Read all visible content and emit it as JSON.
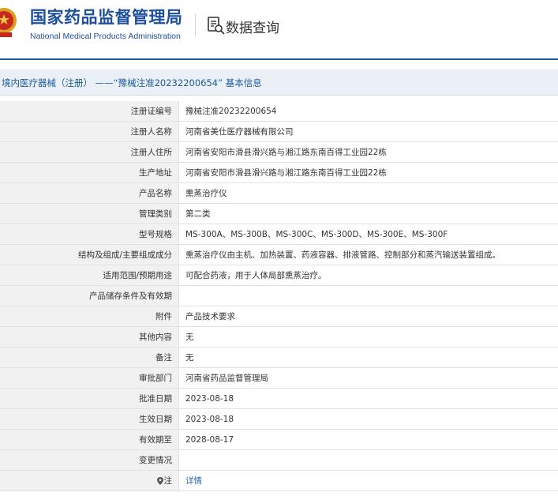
{
  "header": {
    "logo_cn": "国家药品监督管理局",
    "logo_en": "National Medical Products Administration",
    "query_title": "数据查询",
    "icons": {
      "emblem": "national-emblem",
      "query": "document-search-icon"
    },
    "colors": {
      "brand": "#1d4f9c",
      "rule": "#1b5a9e",
      "link": "#2a6ab8"
    }
  },
  "title_bar": {
    "text": "境内医疗器械（注册） ——“豫械注准20232200654” 基本信息"
  },
  "rows": [
    {
      "label": "注册证编号",
      "value": "豫械注准20232200654"
    },
    {
      "label": "注册人名称",
      "value": "河南省美仕医疗器械有限公司"
    },
    {
      "label": "注册人住所",
      "value": "河南省安阳市滑县滑兴路与湘江路东南百得工业园22栋"
    },
    {
      "label": "生产地址",
      "value": "河南省安阳市滑县滑兴路与湘江路东南百得工业园22栋"
    },
    {
      "label": "产品名称",
      "value": "熏蒸治疗仪"
    },
    {
      "label": "管理类别",
      "value": "第二类"
    },
    {
      "label": "型号规格",
      "value": "MS-300A、MS-300B、MS-300C、MS-300D、MS-300E、MS-300F"
    },
    {
      "label": "结构及组成/主要组成成分",
      "value": "熏蒸治疗仪由主机、加热装置、药液容器、排液管路、控制部分和蒸汽输送装置组成。"
    },
    {
      "label": "适用范围/预期用途",
      "value": "可配合药液，用于人体局部熏蒸治疗。"
    },
    {
      "label": "产品储存条件及有效期",
      "value": ""
    },
    {
      "label": "附件",
      "value": "产品技术要求"
    },
    {
      "label": "其他内容",
      "value": "无"
    },
    {
      "label": "备注",
      "value": "无"
    },
    {
      "label": "审批部门",
      "value": "河南省药品监督管理局"
    },
    {
      "label": "批准日期",
      "value": "2023-08-18"
    },
    {
      "label": "生效日期",
      "value": "2023-08-18"
    },
    {
      "label": "有效期至",
      "value": "2028-08-17"
    },
    {
      "label": "变更情况",
      "value": ""
    },
    {
      "label": "注",
      "value": "详情"
    }
  ]
}
